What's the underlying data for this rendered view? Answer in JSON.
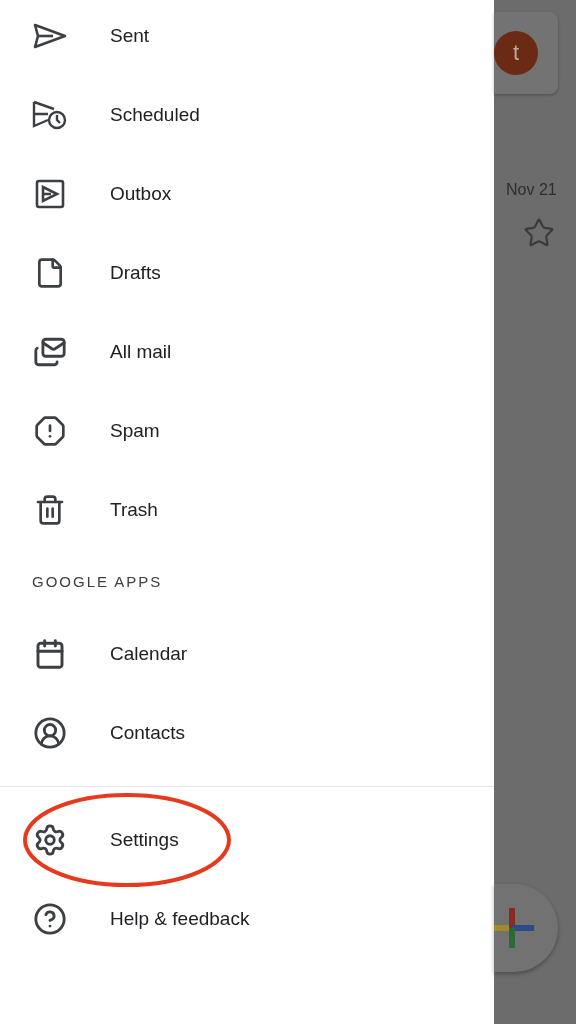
{
  "drawer": {
    "items": [
      {
        "label": "Sent",
        "kind": "sent",
        "highlighted": false
      },
      {
        "label": "Scheduled",
        "kind": "scheduled",
        "highlighted": false
      },
      {
        "label": "Outbox",
        "kind": "outbox",
        "highlighted": false
      },
      {
        "label": "Drafts",
        "kind": "drafts",
        "highlighted": false
      },
      {
        "label": "All mail",
        "kind": "allmail",
        "highlighted": false
      },
      {
        "label": "Spam",
        "kind": "spam",
        "highlighted": false
      },
      {
        "label": "Trash",
        "kind": "trash",
        "highlighted": false
      }
    ],
    "section": {
      "title": "GOOGLE APPS",
      "items": [
        {
          "label": "Calendar",
          "kind": "calendar",
          "highlighted": false
        },
        {
          "label": "Contacts",
          "kind": "contacts",
          "highlighted": false
        }
      ]
    },
    "footer_items": [
      {
        "label": "Settings",
        "kind": "settings",
        "highlighted": true
      },
      {
        "label": "Help & feedback",
        "kind": "help",
        "highlighted": false
      }
    ]
  },
  "background": {
    "avatar": "t",
    "date": "Nov 21"
  }
}
